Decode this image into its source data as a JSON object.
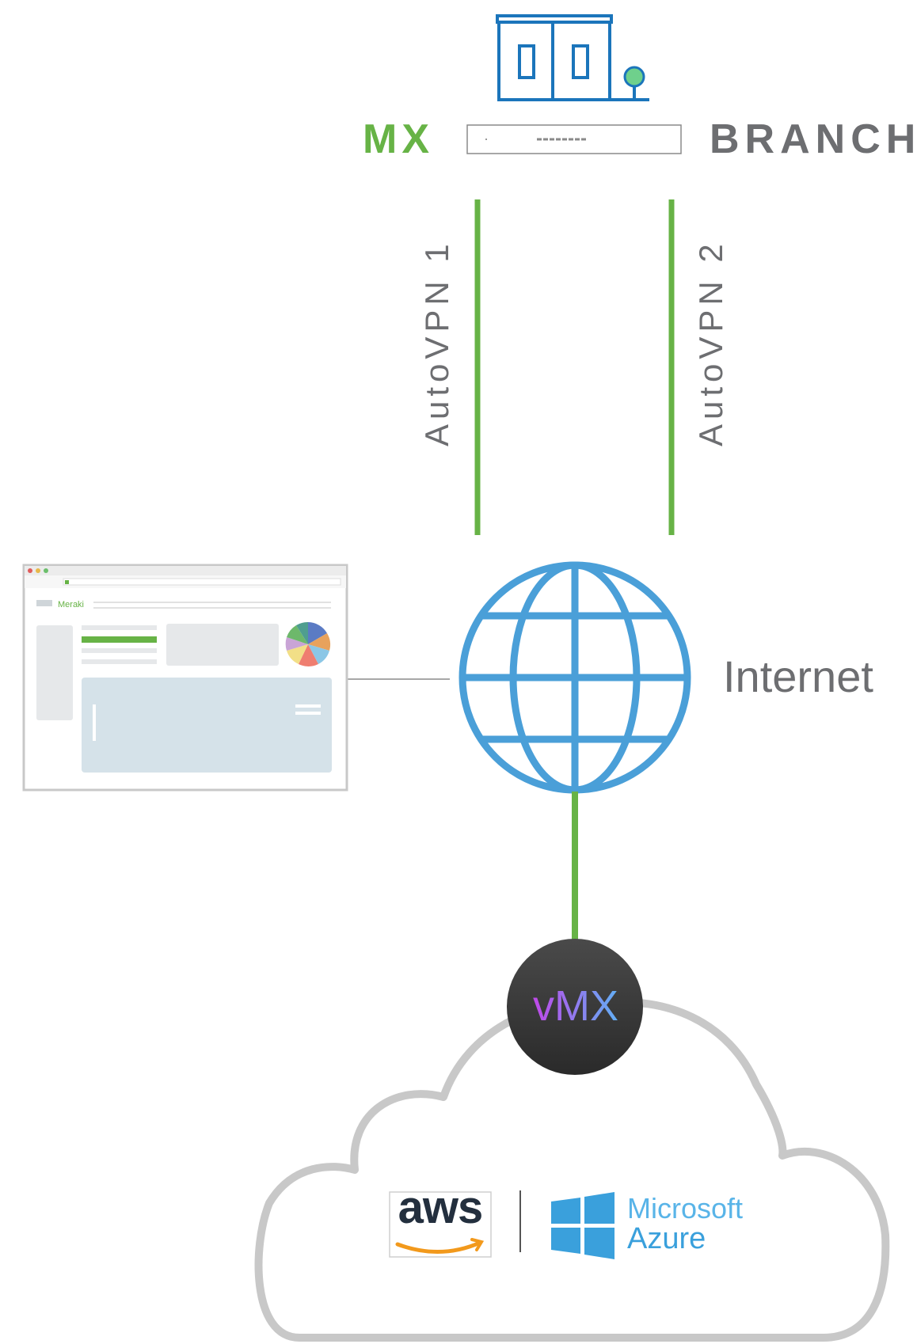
{
  "labels": {
    "mx": "MX",
    "branch": "BRANCH",
    "autovpn1": "AutoVPN 1",
    "autovpn2": "AutoVPN 2",
    "internet": "Internet",
    "vmx": "vMX",
    "aws": "aws",
    "azure_line1": "Microsoft",
    "azure_line2": "Azure",
    "meraki": "Meraki"
  },
  "icons": {
    "branch": "branch-building-icon",
    "mx_appliance": "mx-appliance-icon",
    "internet": "globe-icon",
    "dashboard": "meraki-dashboard-browser-icon",
    "cloud": "cloud-icon",
    "vmx": "vmx-appliance-icon",
    "aws": "aws-logo",
    "windows": "windows-logo"
  },
  "colors": {
    "green": "#67b346",
    "gray_text": "#6d6e71",
    "globe_blue": "#4a9fd8",
    "building_blue": "#1b75bb",
    "cloud_gray": "#c8c8c8",
    "azure_blue": "#3aa0dc"
  }
}
